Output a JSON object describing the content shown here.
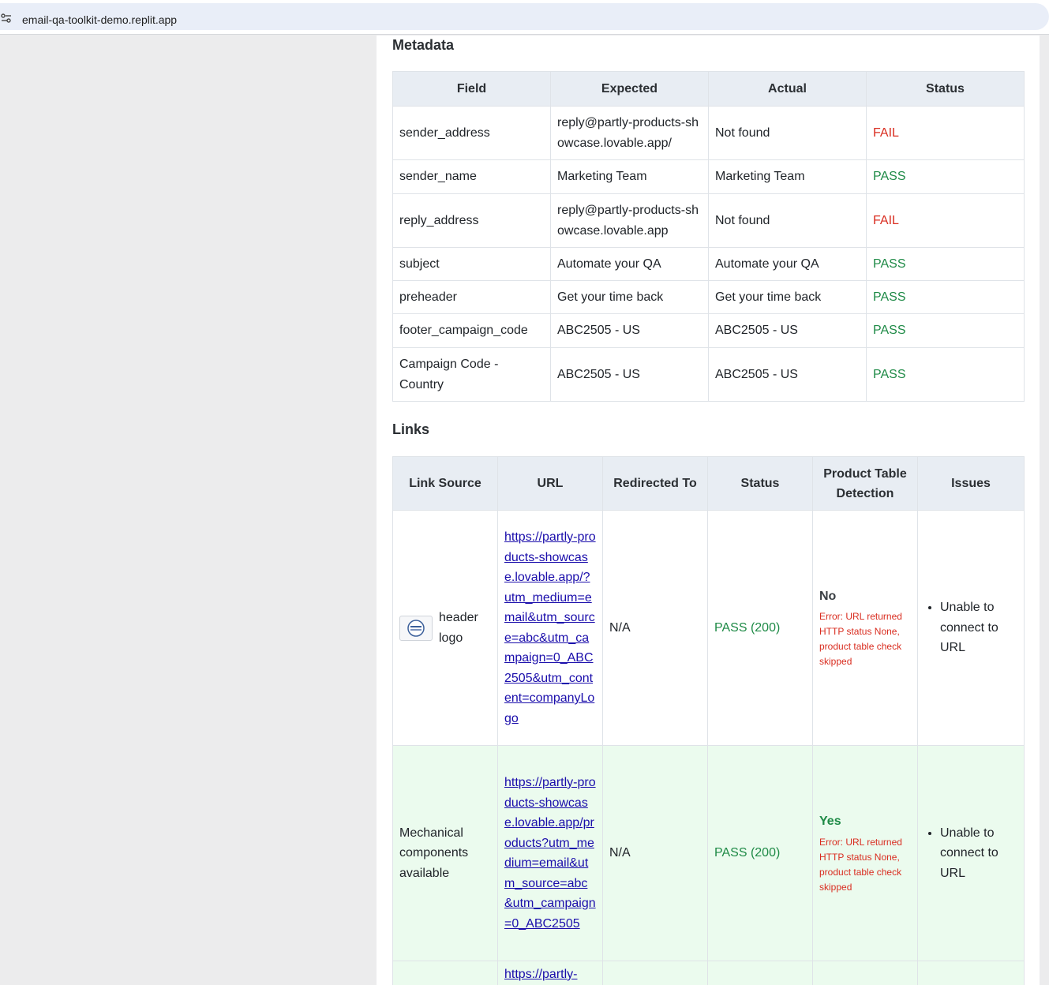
{
  "browser": {
    "url": "email-qa-toolkit-demo.replit.app"
  },
  "metadata": {
    "title": "Metadata",
    "columns": [
      "Field",
      "Expected",
      "Actual",
      "Status"
    ],
    "rows": [
      {
        "field": "sender_address",
        "expected": "reply@partly-products-showcase.lovable.app/",
        "actual": "Not found",
        "status": "FAIL"
      },
      {
        "field": "sender_name",
        "expected": "Marketing Team",
        "actual": "Marketing Team",
        "status": "PASS"
      },
      {
        "field": "reply_address",
        "expected": "reply@partly-products-showcase.lovable.app",
        "actual": "Not found",
        "status": "FAIL"
      },
      {
        "field": "subject",
        "expected": "Automate your QA",
        "actual": "Automate your QA",
        "status": "PASS"
      },
      {
        "field": "preheader",
        "expected": "Get your time back",
        "actual": "Get your time back",
        "status": "PASS"
      },
      {
        "field": "footer_campaign_code",
        "expected": "ABC2505 - US",
        "actual": "ABC2505 - US",
        "status": "PASS"
      },
      {
        "field": "Campaign Code - Country",
        "expected": "ABC2505 - US",
        "actual": "ABC2505 - US",
        "status": "PASS"
      }
    ]
  },
  "links": {
    "title": "Links",
    "columns": [
      "Link Source",
      "URL",
      "Redirected To",
      "Status",
      "Product Table Detection",
      "Issues"
    ],
    "rows": [
      {
        "source": "header logo",
        "url": "https://partly-products-showcase.lovable.app/?utm_medium=email&utm_source=abc&utm_campaign=0_ABC2505&utm_content=companyLogo",
        "redirected": "N/A",
        "status": "PASS (200)",
        "detection": "No",
        "detection_error": "Error: URL returned HTTP status None, product table check skipped",
        "issue": "Unable to connect to URL"
      },
      {
        "source": "Mechanical components available",
        "url": "https://partly-products-showcase.lovable.app/products?utm_medium=email&utm_source=abc&utm_campaign=0_ABC2505",
        "redirected": "N/A",
        "status": "PASS (200)",
        "detection": "Yes",
        "detection_error": "Error: URL returned HTTP status None, product table check skipped",
        "issue": "Unable to connect to URL"
      },
      {
        "url": "https://partly-"
      }
    ]
  },
  "colors": {
    "pass": "#1e8a46",
    "fail": "#d92d20",
    "header_bg": "#e8edf3",
    "row_highlight": "#ebfbee",
    "link": "#1a0dab"
  }
}
